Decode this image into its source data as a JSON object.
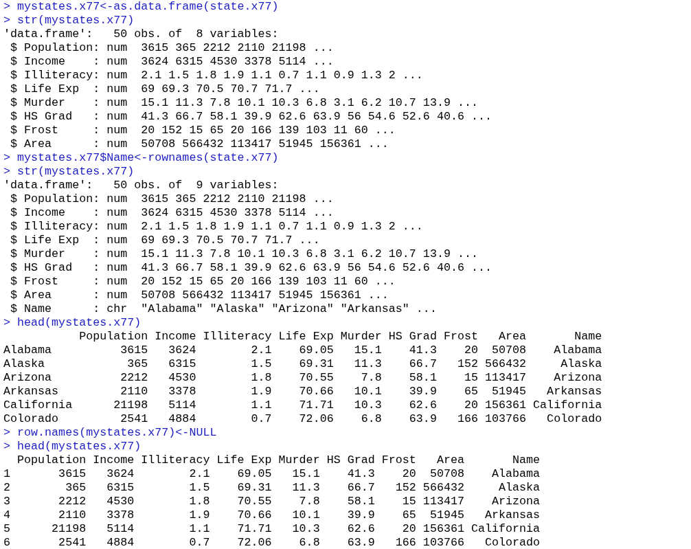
{
  "console": {
    "lines": [
      {
        "kind": "input",
        "prompt": ">",
        "command": "mystates.x77<-as.data.frame(state.x77)"
      },
      {
        "kind": "input",
        "prompt": ">",
        "command": "str(mystates.x77)"
      },
      {
        "kind": "output",
        "text": "'data.frame':   50 obs. of  8 variables:"
      },
      {
        "kind": "output",
        "text": " $ Population: num  3615 365 2212 2110 21198 ..."
      },
      {
        "kind": "output",
        "text": " $ Income    : num  3624 6315 4530 3378 5114 ..."
      },
      {
        "kind": "output",
        "text": " $ Illiteracy: num  2.1 1.5 1.8 1.9 1.1 0.7 1.1 0.9 1.3 2 ..."
      },
      {
        "kind": "output",
        "text": " $ Life Exp  : num  69 69.3 70.5 70.7 71.7 ..."
      },
      {
        "kind": "output",
        "text": " $ Murder    : num  15.1 11.3 7.8 10.1 10.3 6.8 3.1 6.2 10.7 13.9 ..."
      },
      {
        "kind": "output",
        "text": " $ HS Grad   : num  41.3 66.7 58.1 39.9 62.6 63.9 56 54.6 52.6 40.6 ..."
      },
      {
        "kind": "output",
        "text": " $ Frost     : num  20 152 15 65 20 166 139 103 11 60 ..."
      },
      {
        "kind": "output",
        "text": " $ Area      : num  50708 566432 113417 51945 156361 ..."
      },
      {
        "kind": "input",
        "prompt": ">",
        "command": "mystates.x77$Name<-rownames(state.x77)"
      },
      {
        "kind": "input",
        "prompt": ">",
        "command": "str(mystates.x77)"
      },
      {
        "kind": "output",
        "text": "'data.frame':   50 obs. of  9 variables:"
      },
      {
        "kind": "output",
        "text": " $ Population: num  3615 365 2212 2110 21198 ..."
      },
      {
        "kind": "output",
        "text": " $ Income    : num  3624 6315 4530 3378 5114 ..."
      },
      {
        "kind": "output",
        "text": " $ Illiteracy: num  2.1 1.5 1.8 1.9 1.1 0.7 1.1 0.9 1.3 2 ..."
      },
      {
        "kind": "output",
        "text": " $ Life Exp  : num  69 69.3 70.5 70.7 71.7 ..."
      },
      {
        "kind": "output",
        "text": " $ Murder    : num  15.1 11.3 7.8 10.1 10.3 6.8 3.1 6.2 10.7 13.9 ..."
      },
      {
        "kind": "output",
        "text": " $ HS Grad   : num  41.3 66.7 58.1 39.9 62.6 63.9 56 54.6 52.6 40.6 ..."
      },
      {
        "kind": "output",
        "text": " $ Frost     : num  20 152 15 65 20 166 139 103 11 60 ..."
      },
      {
        "kind": "output",
        "text": " $ Area      : num  50708 566432 113417 51945 156361 ..."
      },
      {
        "kind": "output",
        "text": " $ Name      : chr  \"Alabama\" \"Alaska\" \"Arizona\" \"Arkansas\" ..."
      },
      {
        "kind": "input",
        "prompt": ">",
        "command": "head(mystates.x77)"
      },
      {
        "kind": "output",
        "text": "           Population Income Illiteracy Life Exp Murder HS Grad Frost   Area       Name"
      },
      {
        "kind": "output",
        "text": "Alabama          3615   3624        2.1    69.05   15.1    41.3    20  50708    Alabama"
      },
      {
        "kind": "output",
        "text": "Alaska            365   6315        1.5    69.31   11.3    66.7   152 566432     Alaska"
      },
      {
        "kind": "output",
        "text": "Arizona          2212   4530        1.8    70.55    7.8    58.1    15 113417    Arizona"
      },
      {
        "kind": "output",
        "text": "Arkansas         2110   3378        1.9    70.66   10.1    39.9    65  51945   Arkansas"
      },
      {
        "kind": "output",
        "text": "California      21198   5114        1.1    71.71   10.3    62.6    20 156361 California"
      },
      {
        "kind": "output",
        "text": "Colorado         2541   4884        0.7    72.06    6.8    63.9   166 103766   Colorado"
      },
      {
        "kind": "input",
        "prompt": ">",
        "command": "row.names(mystates.x77)<-NULL"
      },
      {
        "kind": "input",
        "prompt": ">",
        "command": "head(mystates.x77)"
      },
      {
        "kind": "output",
        "text": "  Population Income Illiteracy Life Exp Murder HS Grad Frost   Area       Name"
      },
      {
        "kind": "output",
        "text": "1       3615   3624        2.1    69.05   15.1    41.3    20  50708    Alabama"
      },
      {
        "kind": "output",
        "text": "2        365   6315        1.5    69.31   11.3    66.7   152 566432     Alaska"
      },
      {
        "kind": "output",
        "text": "3       2212   4530        1.8    70.55    7.8    58.1    15 113417    Arizona"
      },
      {
        "kind": "output",
        "text": "4       2110   3378        1.9    70.66   10.1    39.9    65  51945   Arkansas"
      },
      {
        "kind": "output",
        "text": "5      21198   5114        1.1    71.71   10.3    62.6    20 156361 California"
      },
      {
        "kind": "output",
        "text": "6       2541   4884        0.7    72.06    6.8    63.9   166 103766   Colorado"
      }
    ]
  }
}
